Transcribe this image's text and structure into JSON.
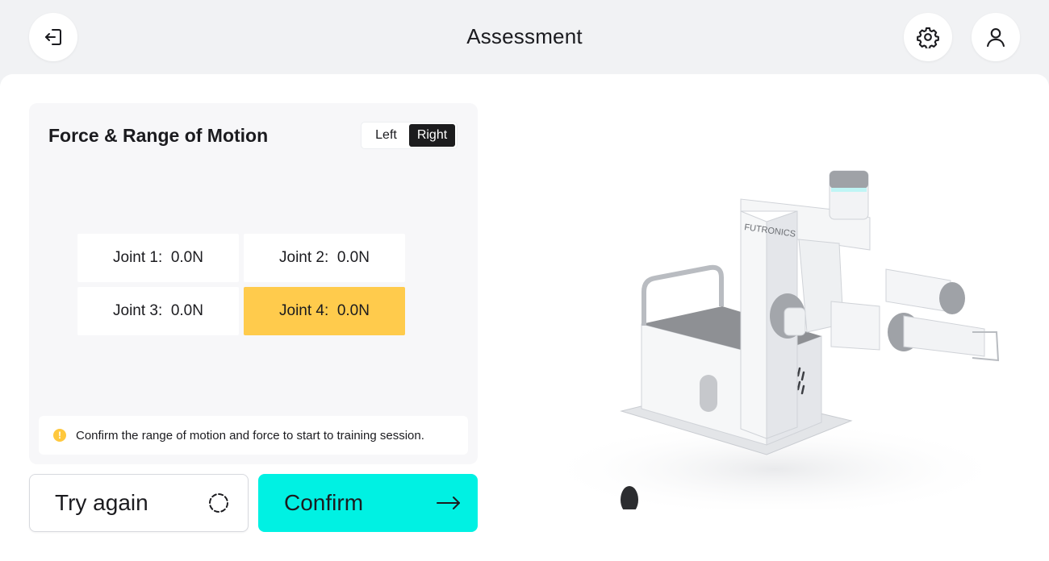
{
  "header": {
    "title": "Assessment",
    "exit_icon": "exit-icon",
    "settings_icon": "gear-icon",
    "profile_icon": "user-icon"
  },
  "panel": {
    "title": "Force & Range of Motion",
    "side_toggle": {
      "options": [
        "Left",
        "Right"
      ],
      "selected": "Right"
    },
    "joints": [
      {
        "label": "Joint 1:  0.0N",
        "selected": false
      },
      {
        "label": "Joint 2:  0.0N",
        "selected": false
      },
      {
        "label": "Joint 3:  0.0N",
        "selected": false
      },
      {
        "label": "Joint 4:  0.0N",
        "selected": true
      }
    ],
    "notice": {
      "icon": "info-icon",
      "text": "Confirm the range of motion and force to start to training session."
    }
  },
  "actions": {
    "try_again": "Try again",
    "confirm": "Confirm"
  },
  "device": {
    "brand": "FUTRONICS"
  },
  "colors": {
    "accent_cyan": "#00f1e3",
    "highlight_yellow": "#ffcb4c",
    "background": "#f1f2f4"
  }
}
